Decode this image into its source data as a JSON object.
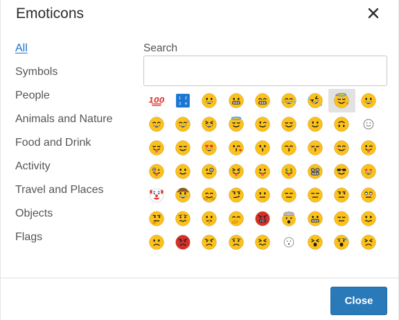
{
  "dialog": {
    "title": "Emoticons",
    "close_label": "Close"
  },
  "nav": {
    "items": [
      {
        "label": "All",
        "active": true
      },
      {
        "label": "Symbols"
      },
      {
        "label": "People"
      },
      {
        "label": "Animals and Nature"
      },
      {
        "label": "Food and Drink"
      },
      {
        "label": "Activity"
      },
      {
        "label": "Travel and Places"
      },
      {
        "label": "Objects"
      },
      {
        "label": "Flags"
      }
    ]
  },
  "search": {
    "label": "Search",
    "value": "",
    "placeholder": ""
  },
  "emojis": [
    "hundred-points-icon",
    "input-numbers-icon",
    "grinning-face-icon",
    "grimacing-face-icon",
    "beaming-face-icon",
    "tears-of-joy-icon",
    "rolling-laughing-icon",
    "smiling-hearts-face-icon",
    "grinning-face-icon",
    "grinning-smiling-eyes-icon",
    "sweat-smile-icon",
    "squinting-grin-icon",
    "smiling-halo-icon",
    "winking-face-icon",
    "blushing-face-icon",
    "slightly-smiling-face-icon",
    "upside-down-face-icon",
    "white-smiling-face-icon",
    "yum-face-icon",
    "relieved-face-icon",
    "heart-eyes-icon",
    "kissing-heart-icon",
    "kissing-face-icon",
    "kissing-smiling-eyes-icon",
    "kissing-closed-eyes-icon",
    "smiling-blush-icon",
    "winking-tongue-icon",
    "zany-face-icon",
    "neutral-smile-icon",
    "monocle-face-icon",
    "squinting-tongue-icon",
    "tongue-face-icon",
    "money-mouth-icon",
    "nerd-face-icon",
    "sunglasses-face-icon",
    "star-struck-icon",
    "clown-face-icon",
    "cowboy-face-icon",
    "hugging-face-icon",
    "smirking-face-icon",
    "neutral-face-icon",
    "expressionless-face-icon",
    "flat-mouth-icon",
    "unamused-face-icon",
    "eye-roll-icon",
    "thinking-face-icon",
    "worried-face-icon",
    "shushing-face-icon",
    "hand-over-mouth-icon",
    "cursing-face-icon",
    "exploding-head-icon",
    "grimace-face-icon",
    "pensive-face-icon",
    "confused-face-icon",
    "frowning-face-icon",
    "angry-face-icon",
    "pouting-face-icon",
    "sad-face-icon",
    "persevering-face-icon",
    "ghost-face-icon",
    "tired-face-icon",
    "anxious-face-icon",
    "weary-face-icon"
  ],
  "selected_index": 7,
  "colors": {
    "accent": "#1a73c9",
    "button": "#2a79b8",
    "emoji_yellow": "#fcc21b",
    "selected_bg": "#e2e2e2"
  }
}
